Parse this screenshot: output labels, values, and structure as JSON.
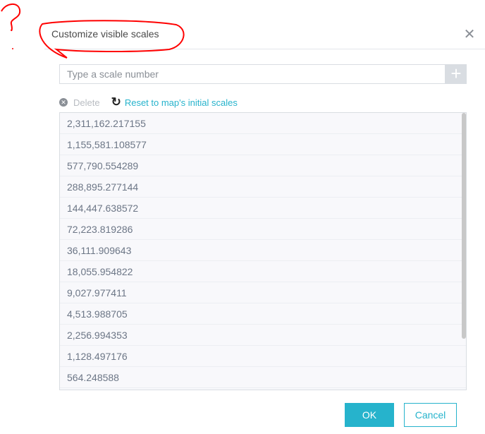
{
  "dialog": {
    "title": "Customize visible scales",
    "close_icon": "close-icon",
    "input_placeholder": "Type a scale number",
    "add_icon": "plus-icon",
    "delete_label": "Delete",
    "reset_label": "Reset to map's initial scales",
    "scales": [
      "2,311,162.217155",
      "1,155,581.108577",
      "577,790.554289",
      "288,895.277144",
      "144,447.638572",
      "72,223.819286",
      "36,111.909643",
      "18,055.954822",
      "9,027.977411",
      "4,513.988705",
      "2,256.994353",
      "1,128.497176",
      "564.248588"
    ],
    "ok_label": "OK",
    "cancel_label": "Cancel"
  },
  "colors": {
    "accent": "#26b3cc",
    "annotation": "#ff0000"
  }
}
